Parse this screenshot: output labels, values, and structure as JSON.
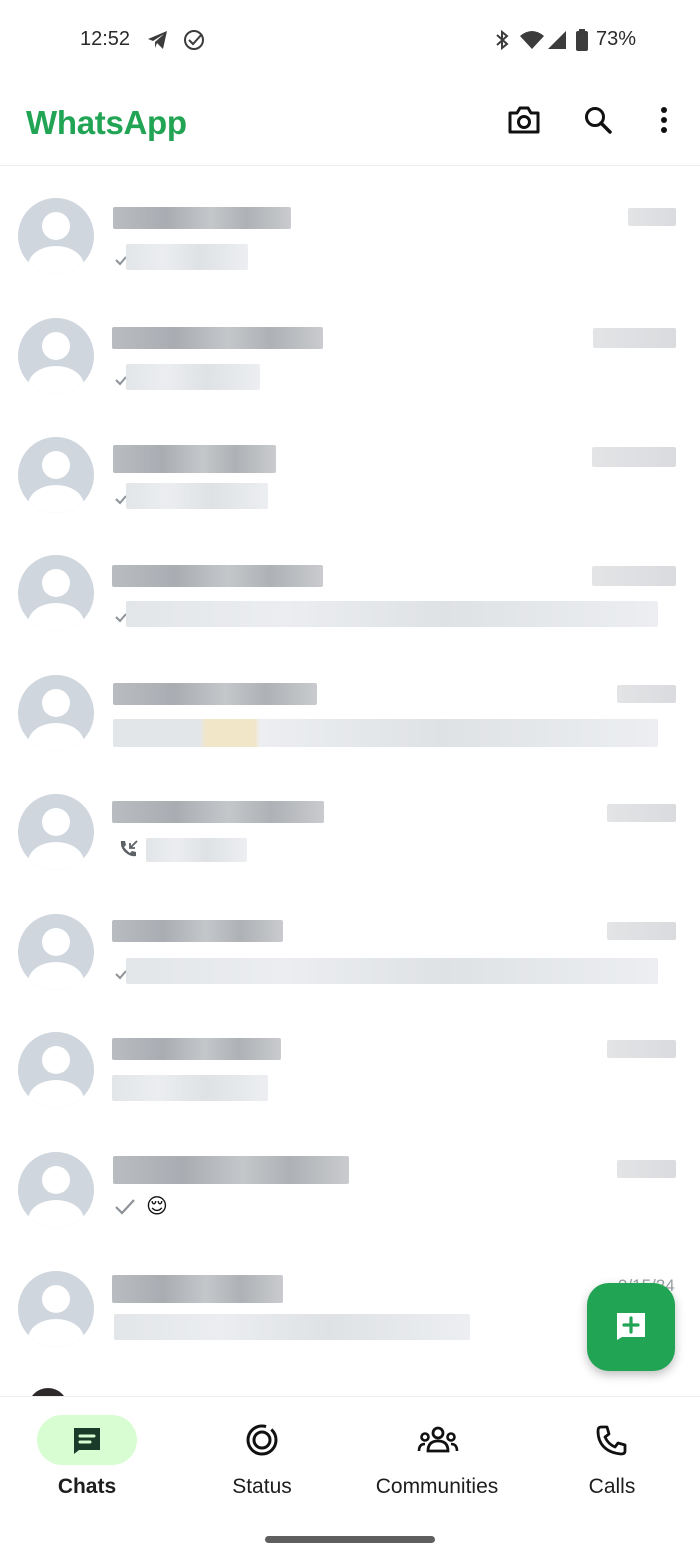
{
  "status_bar": {
    "time": "12:52",
    "battery": "73%",
    "icons": [
      "telegram-icon",
      "check-circle-icon",
      "bluetooth-icon",
      "wifi-icon",
      "signal-icon",
      "battery-icon"
    ]
  },
  "header": {
    "title": "WhatsApp",
    "actions": [
      "camera-icon",
      "search-icon",
      "more-vert-icon"
    ]
  },
  "colors": {
    "brand_green": "#21a453",
    "active_pill": "#d8fdd2",
    "avatar_bg": "#cfd6dd"
  },
  "chat_list": {
    "visible_time_label": "9/15/24",
    "rows": [
      {
        "name": "redacted",
        "preview": "redacted",
        "status_icon": "single-tick-icon"
      },
      {
        "name": "redacted",
        "preview": "redacted",
        "status_icon": "single-tick-icon"
      },
      {
        "name": "redacted",
        "preview": "redacted",
        "status_icon": "single-tick-icon"
      },
      {
        "name": "redacted",
        "preview": "redacted",
        "status_icon": "single-tick-icon"
      },
      {
        "name": "redacted",
        "preview": "redacted",
        "status_icon": "none"
      },
      {
        "name": "redacted",
        "preview": "redacted",
        "status_icon": "missed-call-icon"
      },
      {
        "name": "redacted",
        "preview": "redacted",
        "status_icon": "single-tick-icon"
      },
      {
        "name": "redacted",
        "preview": "redacted",
        "status_icon": "none"
      },
      {
        "name": "redacted",
        "preview": "😌",
        "status_icon": "check-icon"
      },
      {
        "name": "redacted",
        "preview": "redacted",
        "status_icon": "none"
      }
    ]
  },
  "fab": {
    "icon": "new-chat-icon"
  },
  "bottom_nav": {
    "items": [
      {
        "label": "Chats",
        "icon": "chats-icon",
        "active": true
      },
      {
        "label": "Status",
        "icon": "status-icon",
        "active": false
      },
      {
        "label": "Communities",
        "icon": "communities-icon",
        "active": false
      },
      {
        "label": "Calls",
        "icon": "calls-icon",
        "active": false
      }
    ]
  }
}
